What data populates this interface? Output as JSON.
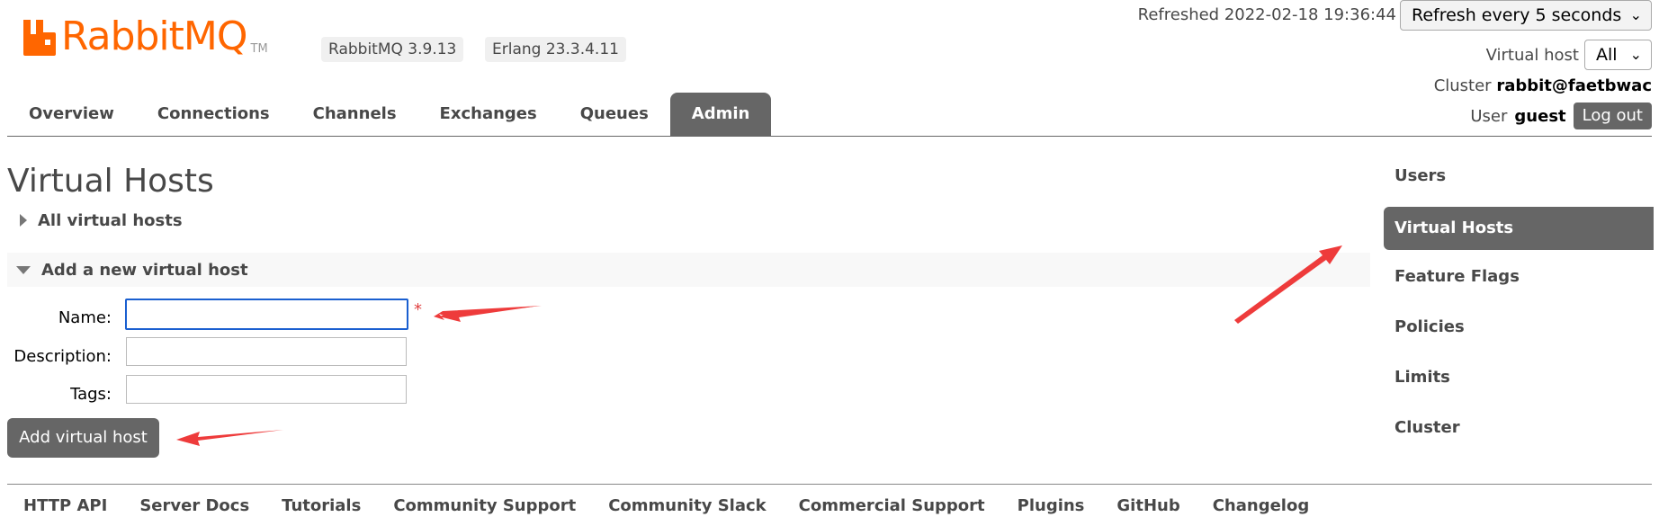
{
  "brand": {
    "name": "RabbitMQ",
    "tm": "TM",
    "color": "#ff6600"
  },
  "versions": {
    "rabbitmq": "RabbitMQ 3.9.13",
    "erlang": "Erlang 23.3.4.11"
  },
  "header": {
    "refreshed": "Refreshed 2022-02-18 19:36:44",
    "refresh_select": "Refresh every 5 seconds",
    "virtual_host_label": "Virtual host",
    "virtual_host_value": "All",
    "cluster_label": "Cluster",
    "cluster_value": "rabbit@faetbwac",
    "user_label": "User",
    "user_value": "guest",
    "logout_label": "Log out"
  },
  "tabs": [
    {
      "label": "Overview",
      "active": false
    },
    {
      "label": "Connections",
      "active": false
    },
    {
      "label": "Channels",
      "active": false
    },
    {
      "label": "Exchanges",
      "active": false
    },
    {
      "label": "Queues",
      "active": false
    },
    {
      "label": "Admin",
      "active": true
    }
  ],
  "main": {
    "title": "Virtual Hosts",
    "all_vhosts_label": "All virtual hosts",
    "add_vhost_label": "Add a new virtual host",
    "form": {
      "name_label": "Name:",
      "description_label": "Description:",
      "tags_label": "Tags:",
      "name_value": "",
      "description_value": "",
      "tags_value": "",
      "required_mark": "*"
    },
    "add_button": "Add virtual host"
  },
  "sidebar": {
    "items": [
      {
        "label": "Users",
        "active": false
      },
      {
        "label": "Virtual Hosts",
        "active": true
      },
      {
        "label": "Feature Flags",
        "active": false
      },
      {
        "label": "Policies",
        "active": false
      },
      {
        "label": "Limits",
        "active": false
      },
      {
        "label": "Cluster",
        "active": false
      }
    ]
  },
  "footer": {
    "links": [
      "HTTP API",
      "Server Docs",
      "Tutorials",
      "Community Support",
      "Community Slack",
      "Commercial Support",
      "Plugins",
      "GitHub",
      "Changelog"
    ]
  },
  "colors": {
    "accent_gray": "#666666",
    "annotation_red": "#ee3b3b",
    "focus_blue": "#1a5fd0"
  }
}
